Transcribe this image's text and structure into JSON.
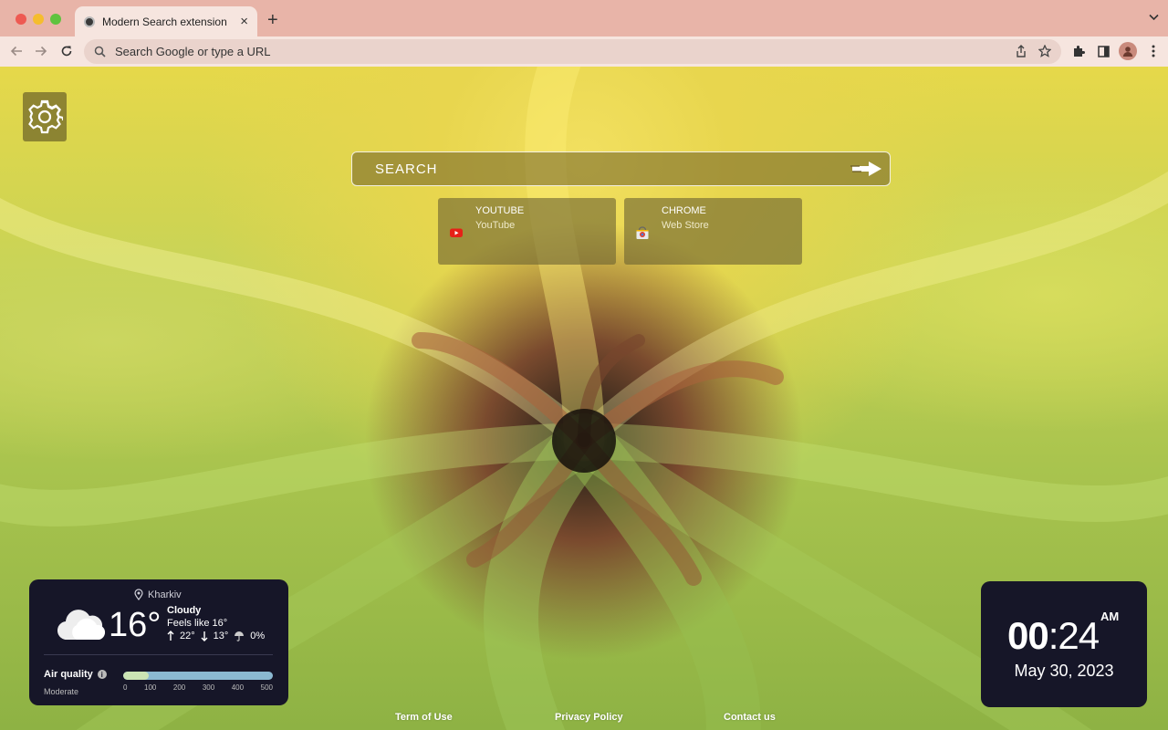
{
  "browser": {
    "tab_title": "Modern Search extension",
    "tab_close": "×",
    "new_tab": "+",
    "tab_menu": "⌄",
    "omnibox_placeholder": "Search Google or type a URL",
    "icons": [
      "back-icon",
      "forward-icon",
      "reload-icon",
      "search-icon",
      "share-icon",
      "star-icon",
      "extensions-icon",
      "side-panel-icon",
      "profile-icon",
      "menu-icon"
    ]
  },
  "search": {
    "placeholder": "SEARCH"
  },
  "shortcuts": [
    {
      "title": "YOUTUBE",
      "subtitle": "YouTube",
      "icon": "youtube-icon"
    },
    {
      "title": "CHROME",
      "subtitle": "Web Store",
      "icon": "chrome-web-store-icon"
    }
  ],
  "weather": {
    "location": "Kharkiv",
    "temperature": "16°",
    "condition": "Cloudy",
    "feels_like": "Feels like 16°",
    "high": "22°",
    "low": "13°",
    "precip": "0%",
    "air_quality_label": "Air quality",
    "air_quality_status": "Moderate",
    "air_quality_value": 0.17,
    "scale": [
      "0",
      "100",
      "200",
      "300",
      "400",
      "500"
    ],
    "icon": "cloud-icon"
  },
  "clock": {
    "hours": "00",
    "separator": ":",
    "minutes": "24",
    "ampm": "AM",
    "date": "May 30, 2023"
  },
  "footer": {
    "terms": "Term of Use",
    "privacy": "Privacy Policy",
    "contact": "Contact us"
  },
  "colors": {
    "titlebar": "#e8b4a8",
    "toolbar": "#f6e5df",
    "widget_bg": "#161628"
  }
}
